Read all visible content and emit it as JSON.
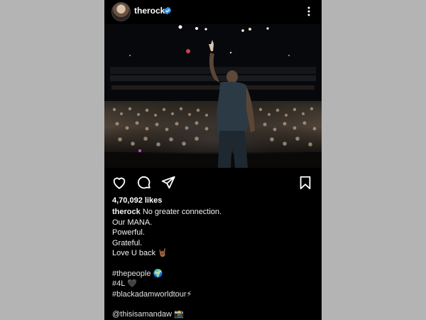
{
  "post": {
    "username": "therock",
    "likes": "4,70,092 likes",
    "caption_first": "No greater connection.",
    "caption_lines": [
      "Our MANA.",
      "Powerful.",
      "Grateful.",
      "Love U back 🤘🏾"
    ],
    "hashtags": [
      "#thepeople 🌍",
      "#4L 🖤",
      "#blackadamworldtour⚡"
    ],
    "mention": "@thisisamandaw 📸"
  },
  "icons": {
    "verified": "verified-badge-icon",
    "menu": "more-options-icon",
    "like": "heart-icon",
    "comment": "comment-icon",
    "share": "send-icon",
    "save": "bookmark-icon"
  },
  "colors": {
    "background": "#000000",
    "verified_blue": "#3897f0",
    "outer": "#b4b4b4"
  }
}
